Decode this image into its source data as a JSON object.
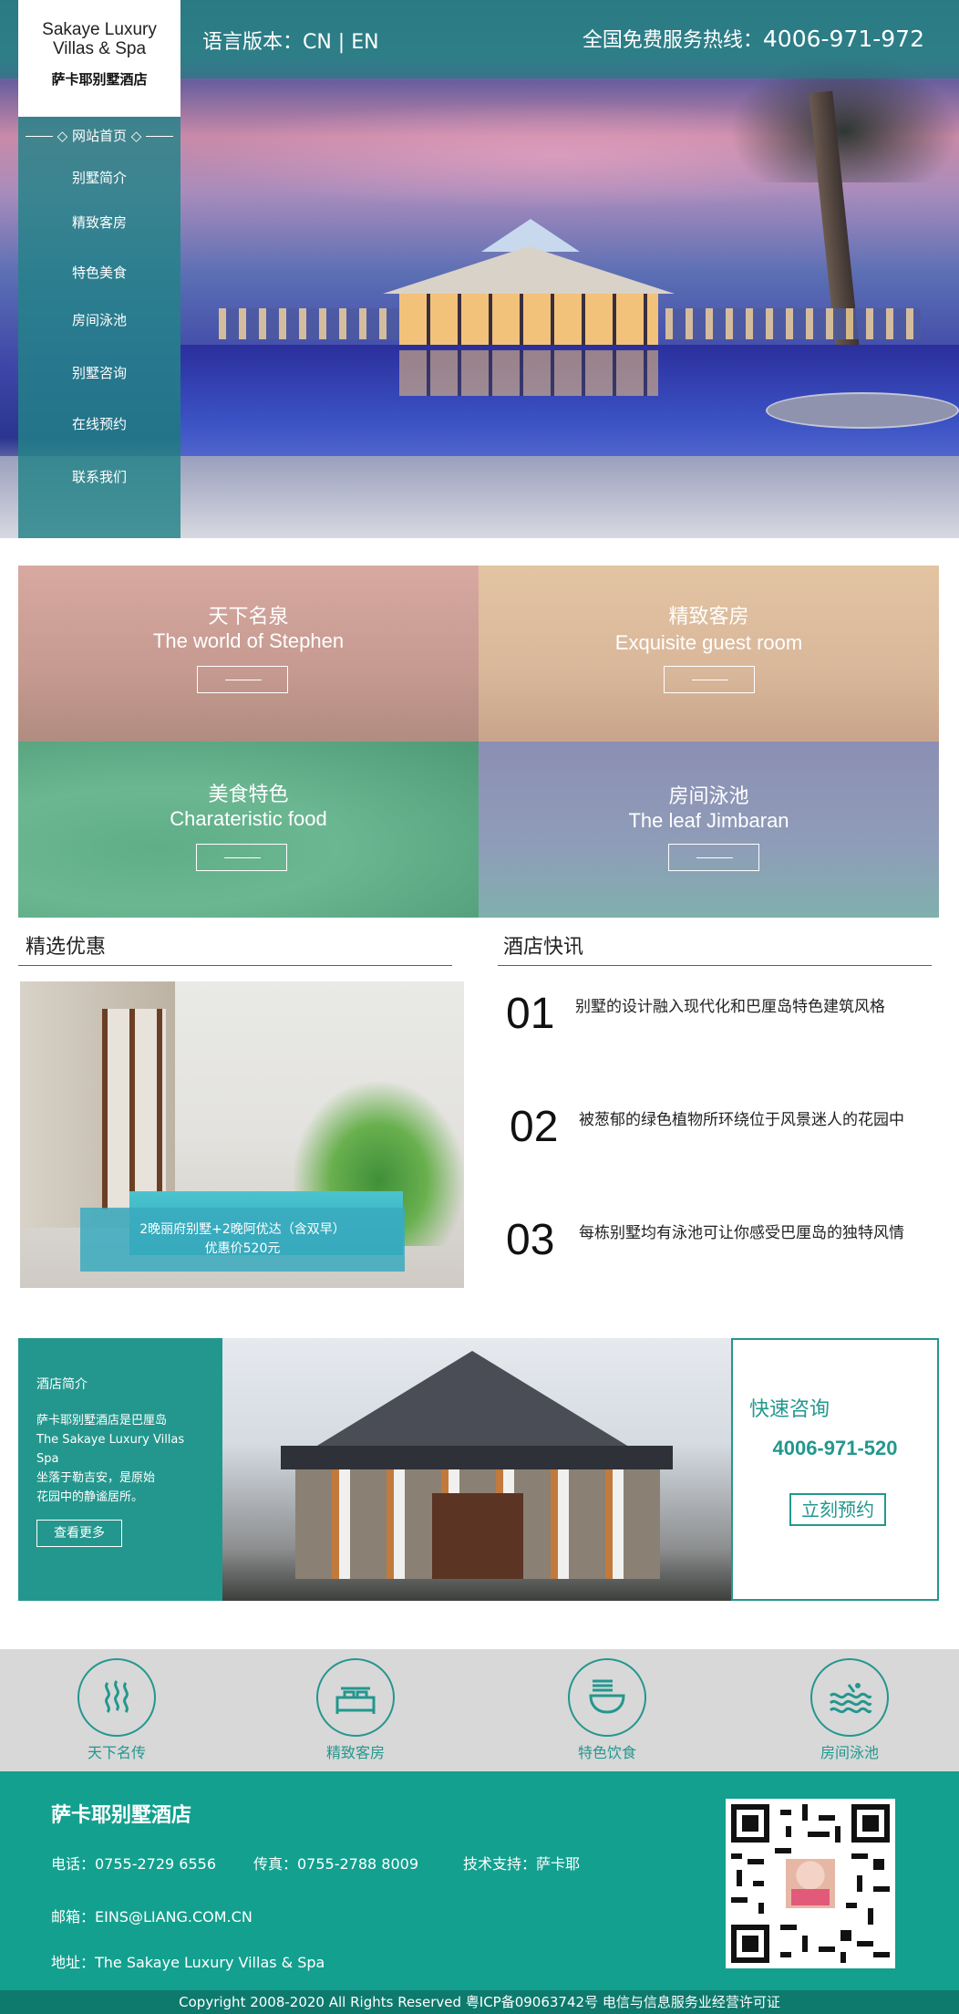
{
  "header": {
    "brand_en": "Sakaye Luxury Villas & Spa",
    "brand_cn": "萨卡耶别墅酒店",
    "lang_label": "语言版本：CN | EN",
    "hotline_label": "全国免费服务热线：",
    "hotline_number": "4006-971-972"
  },
  "nav": {
    "home": "网站首页",
    "items": [
      "别墅简介",
      "精致客房",
      "特色美食",
      "房间泳池",
      "别墅咨询",
      "在线预约",
      "联系我们"
    ]
  },
  "features": [
    {
      "cn": "天下名泉",
      "en": "The world of Stephen"
    },
    {
      "cn": "精致客房",
      "en": "Exquisite guest room"
    },
    {
      "cn": "美食特色",
      "en": "Charateristic food"
    },
    {
      "cn": "房间泳池",
      "en": "The leaf Jimbaran"
    }
  ],
  "promo": {
    "title": "精选优惠",
    "caption_line1": "2晚丽府别墅+2晚阿优达（含双早）",
    "caption_line2": "优惠价520元"
  },
  "news": {
    "title": "酒店快讯",
    "items": [
      {
        "num": "01",
        "text": "别墅的设计融入现代化和巴厘岛特色建筑风格"
      },
      {
        "num": "02",
        "text": "被葱郁的绿色植物所环绕位于风景迷人的花园中"
      },
      {
        "num": "03",
        "text": "每栋别墅均有泳池可让你感受巴厘岛的独特风情"
      }
    ]
  },
  "about": {
    "title": "酒店简介",
    "text_line1": "萨卡耶别墅酒店是巴厘岛",
    "text_line2": "The Sakaye Luxury Villas Spa",
    "text_line3": "坐落于勒吉安，是原始",
    "text_line4": "花园中的静谧居所。",
    "more": "查看更多",
    "consult_title": "快速咨询",
    "consult_phone": "4006-971-520",
    "book_button": "立刻预约"
  },
  "icons": [
    {
      "label": "天下名传",
      "icon": "hot-spring-icon"
    },
    {
      "label": "精致客房",
      "icon": "bed-icon"
    },
    {
      "label": "特色饮食",
      "icon": "noodle-bowl-icon"
    },
    {
      "label": "房间泳池",
      "icon": "pool-wave-icon"
    }
  ],
  "footer": {
    "name": "萨卡耶别墅酒店",
    "phone": "电话：0755-2729 6556",
    "fax": "传真：0755-2788 8009",
    "support": "技术支持：萨卡耶",
    "email": "邮箱：EINS@LIANG.COM.CN",
    "address": "地址：The Sakaye Luxury Villas & Spa",
    "copyright": "Copyright 2008-2020 All Rights Reserved 粤ICP备09063742号 电信与信息服务业经营许可证"
  },
  "colors": {
    "teal": "#23978e",
    "footer": "#13a08f",
    "accent_rule": "#7a5440"
  }
}
